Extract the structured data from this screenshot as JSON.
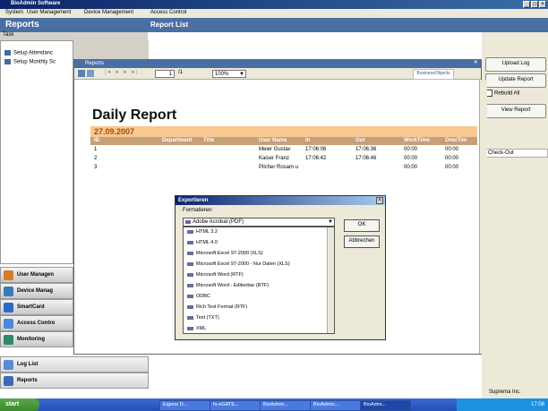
{
  "window": {
    "title": "BioAdmin Software",
    "controls": [
      "_",
      "□",
      "×"
    ]
  },
  "menu": [
    "System",
    "User Management",
    "Device Management",
    "Access Control"
  ],
  "header": {
    "left": "Reports",
    "right": "Report List"
  },
  "task_label": "Task",
  "tasks": [
    "Setup Attendanc",
    "Setup Monthly Sc"
  ],
  "nav": [
    "User Managen",
    "Device Manag",
    "SmartCard",
    "Access Contro",
    "Monitoring",
    "Log List",
    "Reports"
  ],
  "right_buttons": {
    "upload": "Upload Log",
    "update": "Update Report",
    "rebuild": "Rebuild All",
    "view": "View Report",
    "checkout": "Check-Out"
  },
  "report_window": {
    "title": "Reports",
    "page_current": "1",
    "page_total": "/1",
    "zoom": "100%",
    "logo": "BusinessObjects",
    "report_title": "Daily Report",
    "date": "27.09.2007",
    "columns": [
      "ID",
      "Department",
      "Title",
      "User Name",
      "In",
      "Out",
      "WorkTime",
      "OverTim"
    ],
    "rows": [
      [
        "1",
        "",
        "",
        "Meier Gustav",
        "17:06:06",
        "17:06:36",
        "00:00",
        "00:00"
      ],
      [
        "2",
        "",
        "",
        "Kaiser Franz",
        "17:06:42",
        "17:06:46",
        "00:00",
        "00:00"
      ],
      [
        "3",
        "",
        "",
        "Pilcher Rosam u",
        "",
        "",
        "00:00",
        "00:00"
      ]
    ]
  },
  "dialog": {
    "title": "Exportieren",
    "label": "Formatieren:",
    "selected": "Adobe Acrobat (PDF)",
    "options": [
      "HTML 3.2",
      "HTML 4.0",
      "Microsoft Excel 97-2000 (XLS)",
      "Microsoft Excel 97-2000 - Nur Daten (XLS)",
      "Microsoft Word (RTF)",
      "Microsoft Word - Editierbar (RTF)",
      "ODBC",
      "Rich Text Format (RTF)",
      "Text (TXT)",
      "XML"
    ],
    "ok": "OK",
    "cancel": "Abbrechen"
  },
  "taskbar": {
    "start": "start",
    "items": [
      "Eigene D...",
      "fo-eGATE...",
      "BioAdmin...",
      "BioAdmin...",
      "BioAdmi..."
    ],
    "clock": "17:08",
    "vendor": "Suprema Inc."
  }
}
